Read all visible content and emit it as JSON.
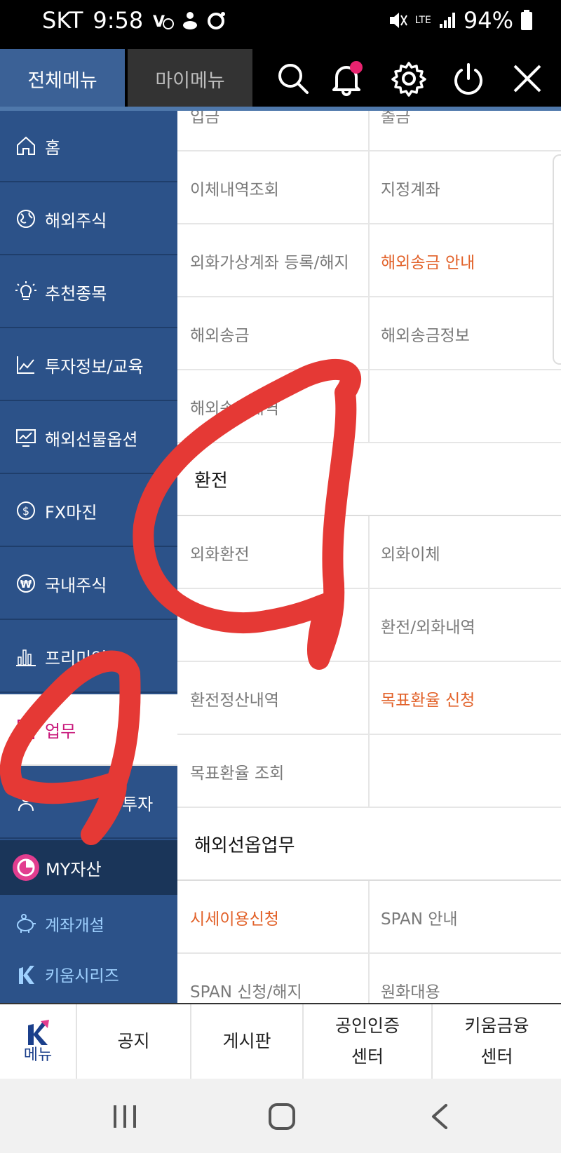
{
  "status_bar": {
    "carrier": "SKT",
    "time": "9:58",
    "network": "LTE",
    "battery": "94%"
  },
  "header": {
    "tab_all": "전체메뉴",
    "tab_my": "마이메뉴",
    "icons": [
      "search-icon",
      "bell-icon",
      "gear-icon",
      "power-icon",
      "close-icon"
    ],
    "notification_dot_color": "#e8236f"
  },
  "sidebar": {
    "items": [
      {
        "label": "홈",
        "icon": "home-icon"
      },
      {
        "label": "해외주식",
        "icon": "globe-icon"
      },
      {
        "label": "추천종목",
        "icon": "lightbulb-icon"
      },
      {
        "label": "투자정보/교육",
        "icon": "line-chart-icon"
      },
      {
        "label": "해외선물옵션",
        "icon": "monitor-chart-icon"
      },
      {
        "label": "FX마진",
        "icon": "dollar-icon"
      },
      {
        "label": "국내주식",
        "icon": "won-icon"
      },
      {
        "label": "프리미엄",
        "icon": "bar-chart-icon"
      },
      {
        "label": "업무",
        "icon": "checklist-icon"
      },
      {
        "label": "투자",
        "icon": "person-icon"
      }
    ],
    "my_assets": "MY자산",
    "sub_items": [
      {
        "label": "계좌개설",
        "icon": "piggy-bank-icon"
      },
      {
        "label": "키움시리즈",
        "icon": "kiwoom-k-icon"
      }
    ],
    "active_color": "#c8167a"
  },
  "content": {
    "rows_top": [
      {
        "c1": "입금",
        "c2": "출금"
      },
      {
        "c1": "이체내역조회",
        "c2": "지정계좌"
      },
      {
        "c1": "외화가상계좌 등록/해지",
        "c2": "해외송금 안내"
      },
      {
        "c1": "해외송금",
        "c2": "해외송금정보"
      },
      {
        "c1": "해외송금내역",
        "c2": ""
      }
    ],
    "section_exchange": "환전",
    "rows_exchange": [
      {
        "c1": "외화환전",
        "c2": "외화이체"
      },
      {
        "c1": "",
        "c2": "환전/외화내역"
      },
      {
        "c1": "환전정산내역",
        "c2": "목표환율 신청"
      },
      {
        "c1": "목표환율 조회",
        "c2": ""
      }
    ],
    "section_futures": "해외선옵업무",
    "rows_futures": [
      {
        "c1": "시세이용신청",
        "c2": "SPAN 안내"
      },
      {
        "c1": "SPAN 신청/해지",
        "c2": "원화대용"
      }
    ],
    "highlight_color": "#e2622a"
  },
  "bottom_bar": {
    "menu_label": "메뉴",
    "items": [
      "공지",
      "게시판",
      "공인인증\n센터",
      "키움금융\n센터"
    ],
    "items_split": [
      [
        "공지"
      ],
      [
        "게시판"
      ],
      [
        "공인인증",
        "센터"
      ],
      [
        "키움금융",
        "센터"
      ]
    ]
  },
  "nav_bar": {
    "icons": [
      "recent-apps-icon",
      "home-button-icon",
      "back-icon"
    ]
  },
  "annotation_color": "#e53935"
}
